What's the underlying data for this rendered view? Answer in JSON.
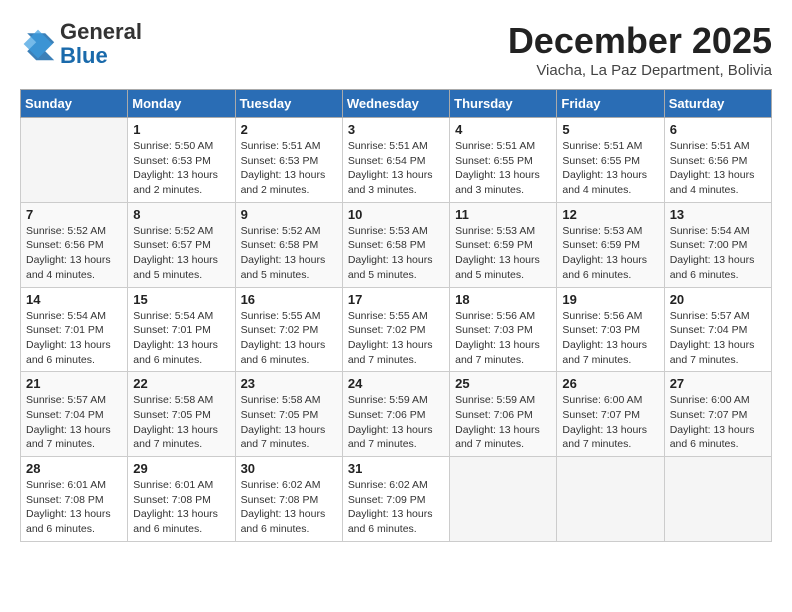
{
  "header": {
    "logo_general": "General",
    "logo_blue": "Blue",
    "month_year": "December 2025",
    "location": "Viacha, La Paz Department, Bolivia"
  },
  "days_of_week": [
    "Sunday",
    "Monday",
    "Tuesday",
    "Wednesday",
    "Thursday",
    "Friday",
    "Saturday"
  ],
  "weeks": [
    [
      null,
      {
        "day": 1,
        "sunrise": "5:50 AM",
        "sunset": "6:53 PM",
        "daylight": "13 hours and 2 minutes."
      },
      {
        "day": 2,
        "sunrise": "5:51 AM",
        "sunset": "6:53 PM",
        "daylight": "13 hours and 2 minutes."
      },
      {
        "day": 3,
        "sunrise": "5:51 AM",
        "sunset": "6:54 PM",
        "daylight": "13 hours and 3 minutes."
      },
      {
        "day": 4,
        "sunrise": "5:51 AM",
        "sunset": "6:55 PM",
        "daylight": "13 hours and 3 minutes."
      },
      {
        "day": 5,
        "sunrise": "5:51 AM",
        "sunset": "6:55 PM",
        "daylight": "13 hours and 4 minutes."
      },
      {
        "day": 6,
        "sunrise": "5:51 AM",
        "sunset": "6:56 PM",
        "daylight": "13 hours and 4 minutes."
      }
    ],
    [
      {
        "day": 7,
        "sunrise": "5:52 AM",
        "sunset": "6:56 PM",
        "daylight": "13 hours and 4 minutes."
      },
      {
        "day": 8,
        "sunrise": "5:52 AM",
        "sunset": "6:57 PM",
        "daylight": "13 hours and 5 minutes."
      },
      {
        "day": 9,
        "sunrise": "5:52 AM",
        "sunset": "6:58 PM",
        "daylight": "13 hours and 5 minutes."
      },
      {
        "day": 10,
        "sunrise": "5:53 AM",
        "sunset": "6:58 PM",
        "daylight": "13 hours and 5 minutes."
      },
      {
        "day": 11,
        "sunrise": "5:53 AM",
        "sunset": "6:59 PM",
        "daylight": "13 hours and 5 minutes."
      },
      {
        "day": 12,
        "sunrise": "5:53 AM",
        "sunset": "6:59 PM",
        "daylight": "13 hours and 6 minutes."
      },
      {
        "day": 13,
        "sunrise": "5:54 AM",
        "sunset": "7:00 PM",
        "daylight": "13 hours and 6 minutes."
      }
    ],
    [
      {
        "day": 14,
        "sunrise": "5:54 AM",
        "sunset": "7:01 PM",
        "daylight": "13 hours and 6 minutes."
      },
      {
        "day": 15,
        "sunrise": "5:54 AM",
        "sunset": "7:01 PM",
        "daylight": "13 hours and 6 minutes."
      },
      {
        "day": 16,
        "sunrise": "5:55 AM",
        "sunset": "7:02 PM",
        "daylight": "13 hours and 6 minutes."
      },
      {
        "day": 17,
        "sunrise": "5:55 AM",
        "sunset": "7:02 PM",
        "daylight": "13 hours and 7 minutes."
      },
      {
        "day": 18,
        "sunrise": "5:56 AM",
        "sunset": "7:03 PM",
        "daylight": "13 hours and 7 minutes."
      },
      {
        "day": 19,
        "sunrise": "5:56 AM",
        "sunset": "7:03 PM",
        "daylight": "13 hours and 7 minutes."
      },
      {
        "day": 20,
        "sunrise": "5:57 AM",
        "sunset": "7:04 PM",
        "daylight": "13 hours and 7 minutes."
      }
    ],
    [
      {
        "day": 21,
        "sunrise": "5:57 AM",
        "sunset": "7:04 PM",
        "daylight": "13 hours and 7 minutes."
      },
      {
        "day": 22,
        "sunrise": "5:58 AM",
        "sunset": "7:05 PM",
        "daylight": "13 hours and 7 minutes."
      },
      {
        "day": 23,
        "sunrise": "5:58 AM",
        "sunset": "7:05 PM",
        "daylight": "13 hours and 7 minutes."
      },
      {
        "day": 24,
        "sunrise": "5:59 AM",
        "sunset": "7:06 PM",
        "daylight": "13 hours and 7 minutes."
      },
      {
        "day": 25,
        "sunrise": "5:59 AM",
        "sunset": "7:06 PM",
        "daylight": "13 hours and 7 minutes."
      },
      {
        "day": 26,
        "sunrise": "6:00 AM",
        "sunset": "7:07 PM",
        "daylight": "13 hours and 7 minutes."
      },
      {
        "day": 27,
        "sunrise": "6:00 AM",
        "sunset": "7:07 PM",
        "daylight": "13 hours and 6 minutes."
      }
    ],
    [
      {
        "day": 28,
        "sunrise": "6:01 AM",
        "sunset": "7:08 PM",
        "daylight": "13 hours and 6 minutes."
      },
      {
        "day": 29,
        "sunrise": "6:01 AM",
        "sunset": "7:08 PM",
        "daylight": "13 hours and 6 minutes."
      },
      {
        "day": 30,
        "sunrise": "6:02 AM",
        "sunset": "7:08 PM",
        "daylight": "13 hours and 6 minutes."
      },
      {
        "day": 31,
        "sunrise": "6:02 AM",
        "sunset": "7:09 PM",
        "daylight": "13 hours and 6 minutes."
      },
      null,
      null,
      null
    ]
  ]
}
